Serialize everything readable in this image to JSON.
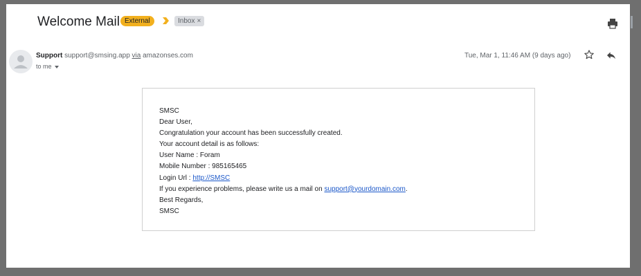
{
  "email": {
    "subject": "Welcome Mail",
    "labels": {
      "external": "External",
      "inbox": "Inbox",
      "inbox_remove": "×"
    },
    "sender": {
      "name": "Support",
      "address": "support@smsing.app",
      "via_word": "via",
      "via_domain": "amazonses.com"
    },
    "to_line": "to me",
    "date": "Tue, Mar 1, 11:46 AM (9 days ago)",
    "body": {
      "line1": "SMSC",
      "line2": "Dear User,",
      "line3": "Congratulation your account has been successfully created.",
      "line4": "Your account detail is as follows:",
      "line5": "User Name : Foram",
      "line6": "Mobile Number : 985165465",
      "line7_prefix": "Login Url : ",
      "line7_link": "http://SMSC",
      "line8_prefix": "If you experience problems, please write us a mail on ",
      "line8_link": "support@yourdomain.com",
      "line8_suffix": ".",
      "line9": "Best Regards,",
      "line10": "SMSC"
    }
  },
  "icons": {
    "print": "print-icon",
    "star": "star-icon",
    "reply": "reply-icon",
    "avatar": "avatar-icon",
    "label_arrow": "label-arrow-icon",
    "more": "more-icon"
  },
  "colors": {
    "external_label": "#f2b01e",
    "inbox_label": "#dadce0",
    "link": "#1a57c9",
    "frame": "#6f6f6f"
  }
}
